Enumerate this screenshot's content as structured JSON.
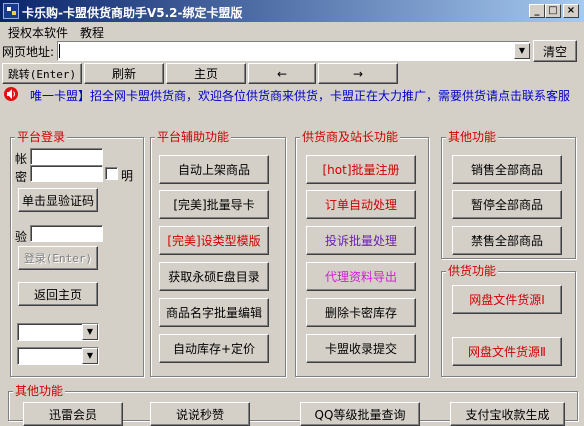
{
  "window": {
    "title": "卡乐购-卡盟供货商助手V5.2-绑定卡盟版",
    "minimize": "_",
    "maximize": "□",
    "close": "×"
  },
  "menu": [
    "授权本软件",
    "教程"
  ],
  "url": {
    "label": "网页地址:",
    "value": "",
    "clear_label": "清空"
  },
  "nav": {
    "go": "跳转(Enter)",
    "refresh": "刷新",
    "home": "主页",
    "back": "←",
    "forward": "→"
  },
  "notice": {
    "text": "唯一卡盟】招全网卡盟供货商，欢迎各位供货商来供货，卡盟正在大力推广，需要供货请点击联系客服"
  },
  "login": {
    "title": "平台登录",
    "account_label": "帐",
    "password_label": "密",
    "show_label": "明",
    "captcha_button": "单击显验证码",
    "captcha_label": "验",
    "login_button": "登录(Enter)",
    "home_button": "返回主页"
  },
  "aux": {
    "title": "平台辅助功能",
    "buttons": [
      "自动上架商品",
      "[完美]批量导卡",
      "[完美]设类型模版",
      "获取永硕E盘目录",
      "商品名字批量编辑",
      "自动库存+定价"
    ]
  },
  "supplier": {
    "title": "供货商及站长功能",
    "buttons": [
      "[hot]批量注册",
      "订单自动处理",
      "投诉批量处理",
      "代理资料导出",
      "删除卡密库存",
      "卡盟收录提交"
    ]
  },
  "other": {
    "title": "其他功能",
    "buttons": [
      "销售全部商品",
      "暂停全部商品",
      "禁售全部商品"
    ]
  },
  "supply": {
    "title": "供货功能",
    "buttons": [
      "网盘文件货源Ⅰ",
      "网盘文件货源Ⅱ"
    ]
  },
  "bottom": {
    "title": "其他功能",
    "buttons": [
      "迅雷会员",
      "说说秒赞",
      "QQ等级批量查询",
      "支付宝收款生成"
    ]
  },
  "colors": {
    "titlebar_start": "#0a246a",
    "titlebar_end": "#a6caf0",
    "face": "#d4d0c8",
    "group_label": "#d00000",
    "notice": "#0000cc"
  }
}
